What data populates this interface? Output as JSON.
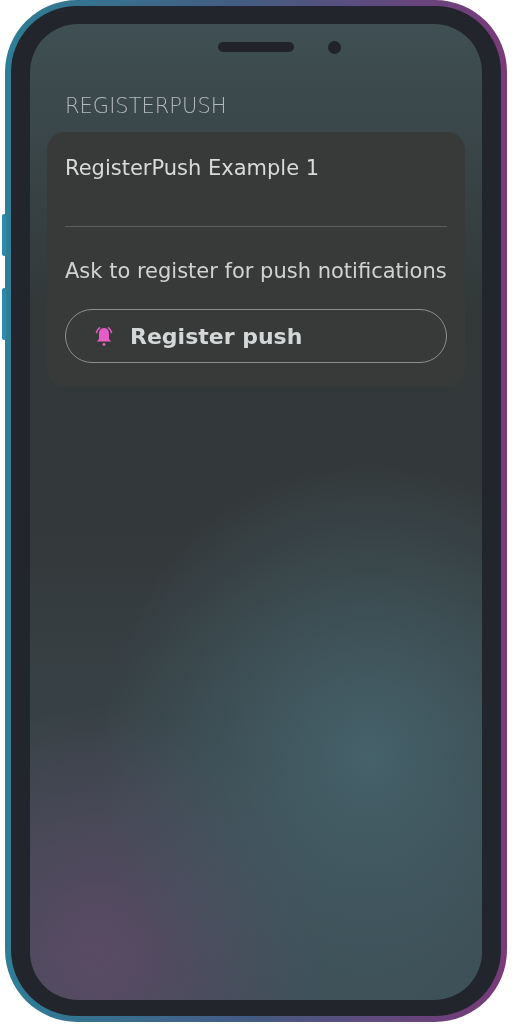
{
  "section_title": "REGISTERPUSH",
  "card": {
    "title": "RegisterPush Example 1",
    "description": "Ask to register for push notifications",
    "button": {
      "label": "Register push"
    }
  }
}
